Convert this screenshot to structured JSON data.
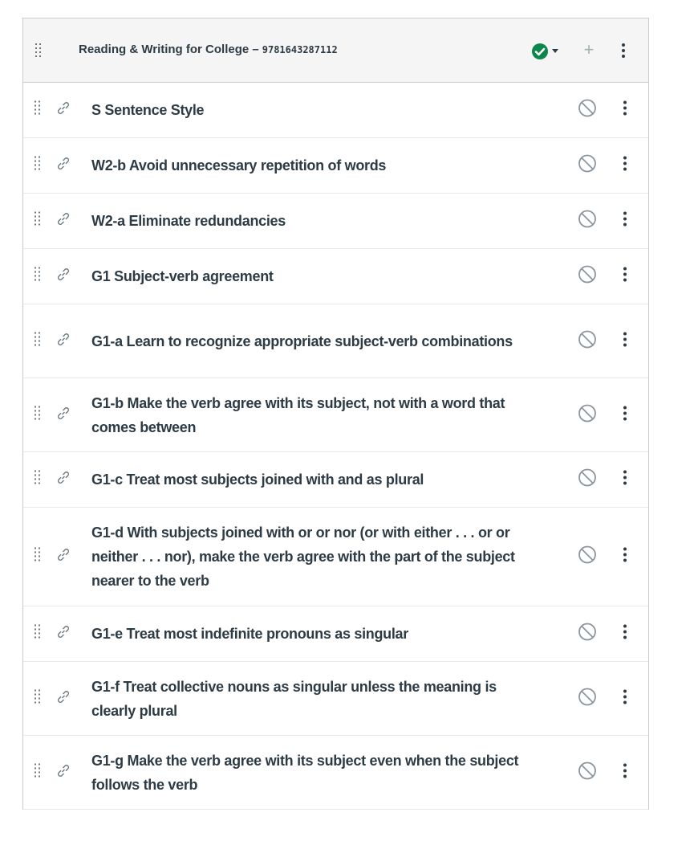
{
  "module": {
    "title": "Reading & Writing for College –",
    "isbn": "9781643287112",
    "status": "published",
    "add_label": "+",
    "status_color": "#0b874b"
  },
  "items": [
    {
      "title": "S Sentence Style",
      "status": "unpublished"
    },
    {
      "title": "W2-b Avoid unnecessary repetition of words",
      "status": "unpublished"
    },
    {
      "title": "W2-a Eliminate redundancies",
      "status": "unpublished"
    },
    {
      "title": "G1 Subject-verb agreement",
      "status": "unpublished"
    },
    {
      "title": "G1-a Learn to recognize appropriate subject-verb combinations",
      "status": "unpublished"
    },
    {
      "title": "G1-b Make the verb agree with its subject, not with a word that comes between",
      "status": "unpublished"
    },
    {
      "title": "G1-c Treat most subjects joined with and as plural",
      "status": "unpublished"
    },
    {
      "title": "G1-d With subjects joined with or or nor (or with either . . . or or neither . . . nor), make the verb agree with the part of the subject nearer to the verb",
      "status": "unpublished"
    },
    {
      "title": "G1-e Treat most indefinite pronouns as singular",
      "status": "unpublished"
    },
    {
      "title": "G1-f Treat collective nouns as singular unless the meaning is clearly plural",
      "status": "unpublished"
    },
    {
      "title": "G1-g Make the verb agree with its subject even when the subject follows the verb",
      "status": "unpublished"
    }
  ],
  "icons": {
    "drag": "drag-handle-icon",
    "link": "link-icon",
    "unpublished": "unpublished-icon",
    "published": "published-check-icon",
    "menu": "kebab-menu-icon",
    "caret": "caret-down-icon",
    "add": "plus-icon"
  }
}
